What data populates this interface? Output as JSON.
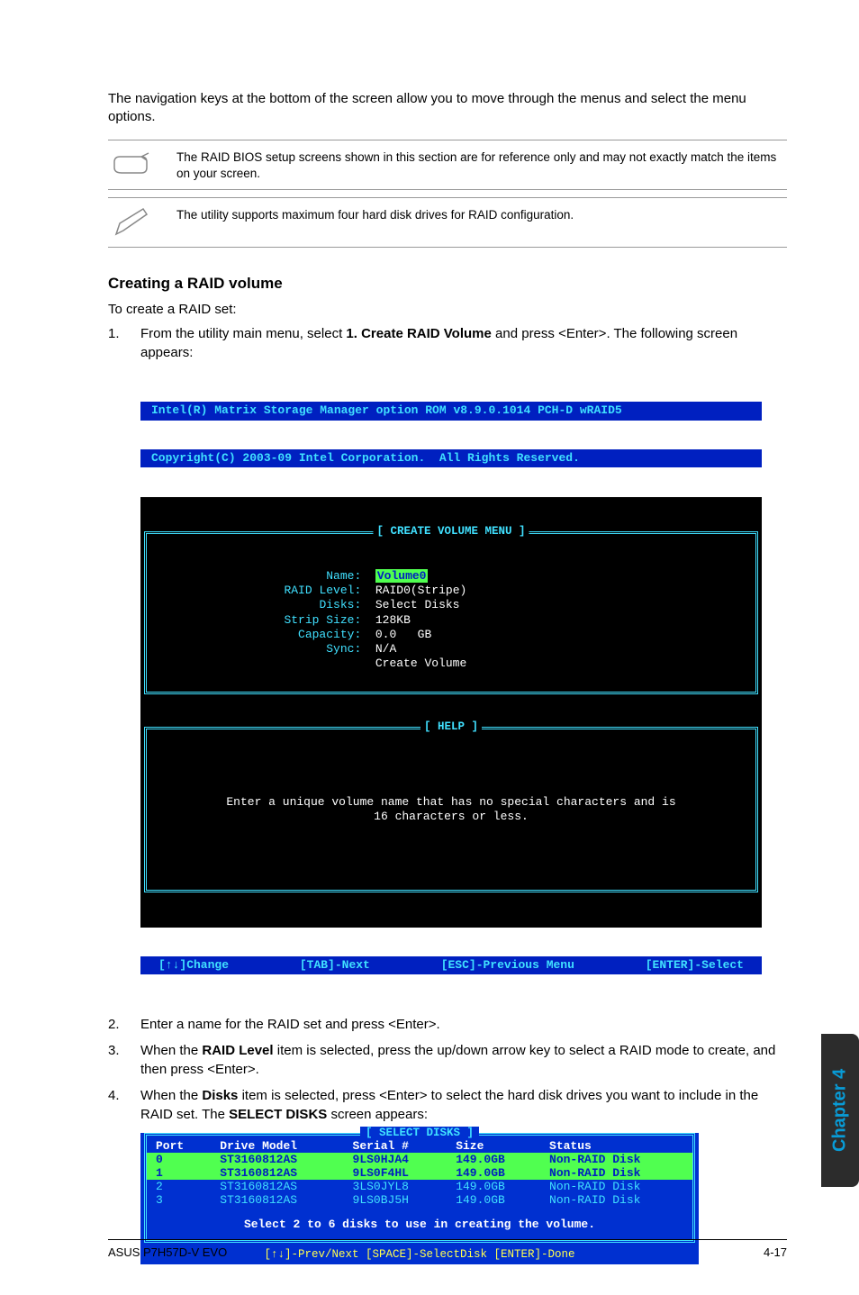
{
  "intro": "The navigation keys at the bottom of the screen allow you to move through the menus and select the menu options.",
  "note1": "The RAID BIOS setup screens shown in this section are for reference only and may not exactly match the items on your screen.",
  "note2": "The utility supports maximum four hard disk drives for RAID configuration.",
  "heading": "Creating a RAID volume",
  "subtext": "To create a RAID set:",
  "step1_num": "1.",
  "step1_a": "From the utility main menu, select ",
  "step1_b": "1. Create RAID Volume",
  "step1_c": " and press <Enter>. The following screen appears:",
  "bios": {
    "top1": "Intel(R) Matrix Storage Manager option ROM v8.9.0.1014 PCH-D wRAID5",
    "top2": "Copyright(C) 2003-09 Intel Corporation.  All Rights Reserved.",
    "menu_title": "[ CREATE VOLUME MENU ]",
    "fields": {
      "name_lbl": "Name:",
      "name_val": "Volume0",
      "raid_lbl": "RAID Level:",
      "raid_val": "RAID0(Stripe)",
      "disks_lbl": "Disks:",
      "disks_val": "Select Disks",
      "strip_lbl": "Strip Size:",
      "strip_val": "128KB",
      "cap_lbl": "Capacity:",
      "cap_val": "0.0   GB",
      "sync_lbl": "Sync:",
      "sync_val": "N/A",
      "create": "Create Volume"
    },
    "help_title": "[ HELP ]",
    "help1": "Enter a unique volume name that has no special characters and is",
    "help2": "16 characters or less.",
    "footer": {
      "change": "[↑↓]Change",
      "next": "[TAB]-Next",
      "prev": "[ESC]-Previous Menu",
      "select": "[ENTER]-Select"
    }
  },
  "step2_num": "2.",
  "step2": "Enter a name for the RAID set and press <Enter>.",
  "step3_num": "3.",
  "step3_a": "When the ",
  "step3_b": "RAID Level",
  "step3_c": " item is selected, press the up/down arrow key to select a RAID mode to create, and then press <Enter>.",
  "step4_num": "4.",
  "step4_a": "When the ",
  "step4_b": "Disks",
  "step4_c": " item is selected, press <Enter> to select the hard disk drives you want to include in the RAID set. The ",
  "step4_d": "SELECT DISKS",
  "step4_e": " screen appears:",
  "disks": {
    "title": "[ SELECT DISKS ]",
    "hdr": {
      "port": "Port",
      "model": "Drive Model",
      "serial": "Serial #",
      "size": "Size",
      "status": "Status"
    },
    "rows": [
      {
        "port": "0",
        "model": "ST3160812AS",
        "serial": "9LS0HJA4",
        "size": "149.0GB",
        "status": "Non-RAID Disk",
        "sel": true
      },
      {
        "port": "1",
        "model": "ST3160812AS",
        "serial": "9LS0F4HL",
        "size": "149.0GB",
        "status": "Non-RAID Disk",
        "sel": true
      },
      {
        "port": "2",
        "model": "ST3160812AS",
        "serial": "3LS0JYL8",
        "size": "149.0GB",
        "status": "Non-RAID Disk",
        "sel": false
      },
      {
        "port": "3",
        "model": "ST3160812AS",
        "serial": "9LS0BJ5H",
        "size": "149.0GB",
        "status": "Non-RAID Disk",
        "sel": false
      }
    ],
    "msg": "Select 2 to 6 disks to use in creating the volume.",
    "nav": "[↑↓]-Prev/Next [SPACE]-SelectDisk [ENTER]-Done"
  },
  "side_tab": "Chapter 4",
  "footer_left": "ASUS P7H57D-V EVO",
  "footer_right": "4-17"
}
